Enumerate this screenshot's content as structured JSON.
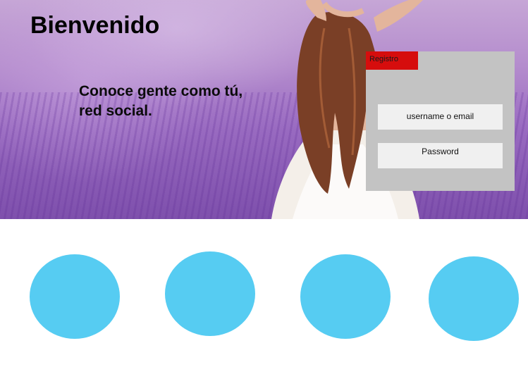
{
  "hero": {
    "title": "Bienvenido",
    "tagline_line1": "Conoce gente como tú,",
    "tagline_line2": "red social."
  },
  "login": {
    "register_label": "Registro",
    "username_placeholder": "username o email",
    "password_placeholder": "Password"
  },
  "colors": {
    "register_tab": "#d60d0d",
    "panel": "#c3c3c3",
    "circles": "#56ccf2"
  },
  "features": {
    "items": [
      {
        "icon": "circle"
      },
      {
        "icon": "circle"
      },
      {
        "icon": "circle"
      },
      {
        "icon": "circle"
      }
    ]
  }
}
